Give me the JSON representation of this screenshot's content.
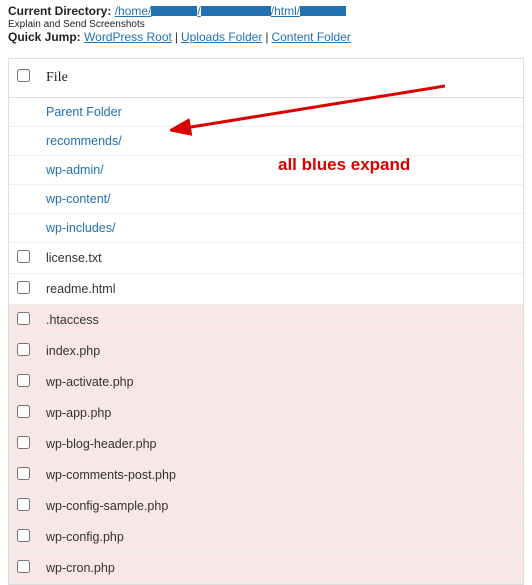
{
  "header": {
    "current_dir_label": "Current Directory:",
    "path_prefix": "/home/",
    "path_mid": "/html/",
    "explain_text": "Explain and Send Screenshots",
    "quick_jump_label": "Quick Jump:",
    "quick_links": [
      "WordPress Root",
      "Uploads Folder",
      "Content Folder"
    ]
  },
  "table": {
    "col_file": "File",
    "rows": [
      {
        "type": "folder",
        "name": "Parent Folder",
        "cb": false
      },
      {
        "type": "folder",
        "name": "recommends/",
        "cb": false
      },
      {
        "type": "folder",
        "name": "wp-admin/",
        "cb": false
      },
      {
        "type": "folder",
        "name": "wp-content/",
        "cb": false
      },
      {
        "type": "folder",
        "name": "wp-includes/",
        "cb": false
      },
      {
        "type": "plain",
        "name": "license.txt",
        "cb": true
      },
      {
        "type": "plain",
        "name": "readme.html",
        "cb": true
      },
      {
        "type": "php",
        "name": ".htaccess",
        "cb": true
      },
      {
        "type": "php",
        "name": "index.php",
        "cb": true
      },
      {
        "type": "php",
        "name": "wp-activate.php",
        "cb": true
      },
      {
        "type": "php",
        "name": "wp-app.php",
        "cb": true
      },
      {
        "type": "php",
        "name": "wp-blog-header.php",
        "cb": true
      },
      {
        "type": "php",
        "name": "wp-comments-post.php",
        "cb": true
      },
      {
        "type": "php",
        "name": "wp-config-sample.php",
        "cb": true
      },
      {
        "type": "php",
        "name": "wp-config.php",
        "cb": true
      },
      {
        "type": "php",
        "name": "wp-cron.php",
        "cb": true
      }
    ]
  },
  "annotation": {
    "text": "all blues expand"
  }
}
